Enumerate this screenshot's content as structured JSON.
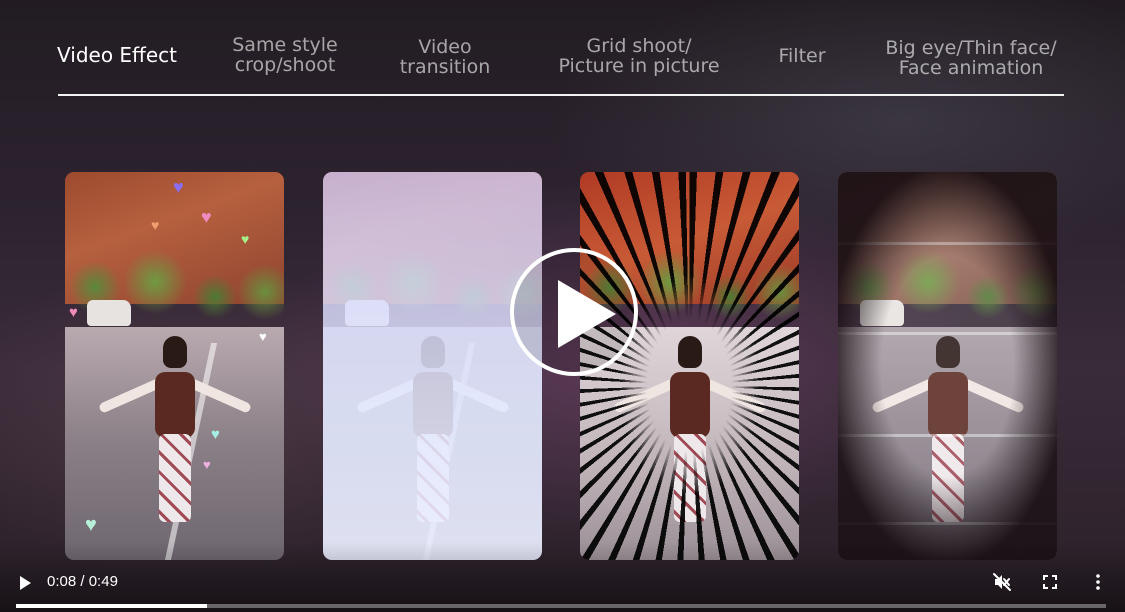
{
  "tabs": [
    {
      "line1": "Video Effect",
      "line2": "",
      "active": true
    },
    {
      "line1": "Same style",
      "line2": "crop/shoot",
      "active": false
    },
    {
      "line1": "Video",
      "line2": "transition",
      "active": false
    },
    {
      "line1": "Grid shoot/",
      "line2": "Picture in picture",
      "active": false
    },
    {
      "line1": "Filter",
      "line2": "",
      "active": false
    },
    {
      "line1": "Big eye/Thin face/",
      "line2": "Face animation",
      "active": false
    }
  ],
  "player": {
    "current_time": "0:08",
    "separator": " / ",
    "duration": "0:49",
    "progress": 0.175,
    "muted": true
  },
  "icons": {
    "big_play": "play-circle-icon",
    "play": "play-icon",
    "mute": "volume-muted-icon",
    "fullscreen": "fullscreen-icon",
    "more": "more-vertical-icon"
  },
  "panels": [
    {
      "effect": "hearts"
    },
    {
      "effect": "light-fade"
    },
    {
      "effect": "speed-lines"
    },
    {
      "effect": "vignette-scanlines"
    }
  ]
}
